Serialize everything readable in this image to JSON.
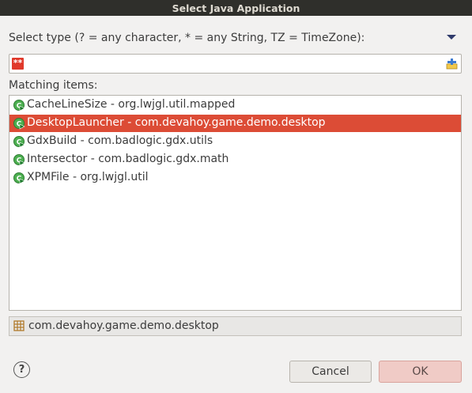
{
  "window": {
    "title": "Select Java Application"
  },
  "filter": {
    "label": "Select type (? = any character, * = any String, TZ = TimeZone):",
    "value": "",
    "error_badge": "**",
    "menu_icon": "triangle-down-icon",
    "history_icon": "history-icon"
  },
  "matching": {
    "label": "Matching items:",
    "items": [
      {
        "label": "CacheLineSize - org.lwjgl.util.mapped",
        "selected": false,
        "icon": "runnable-class-icon"
      },
      {
        "label": "DesktopLauncher - com.devahoy.game.demo.desktop",
        "selected": true,
        "icon": "runnable-class-icon"
      },
      {
        "label": "GdxBuild - com.badlogic.gdx.utils",
        "selected": false,
        "icon": "runnable-class-icon"
      },
      {
        "label": "Intersector - com.badlogic.gdx.math",
        "selected": false,
        "icon": "runnable-class-icon"
      },
      {
        "label": "XPMFile - org.lwjgl.util",
        "selected": false,
        "icon": "runnable-class-icon"
      }
    ]
  },
  "status": {
    "package": "com.devahoy.game.demo.desktop",
    "icon": "package-icon"
  },
  "buttons": {
    "help": "?",
    "cancel": "Cancel",
    "ok": "OK"
  },
  "colors": {
    "selection": "#dc4c36",
    "title_bar": "#2f2f2b",
    "ok_button": "#f0cbc6"
  }
}
